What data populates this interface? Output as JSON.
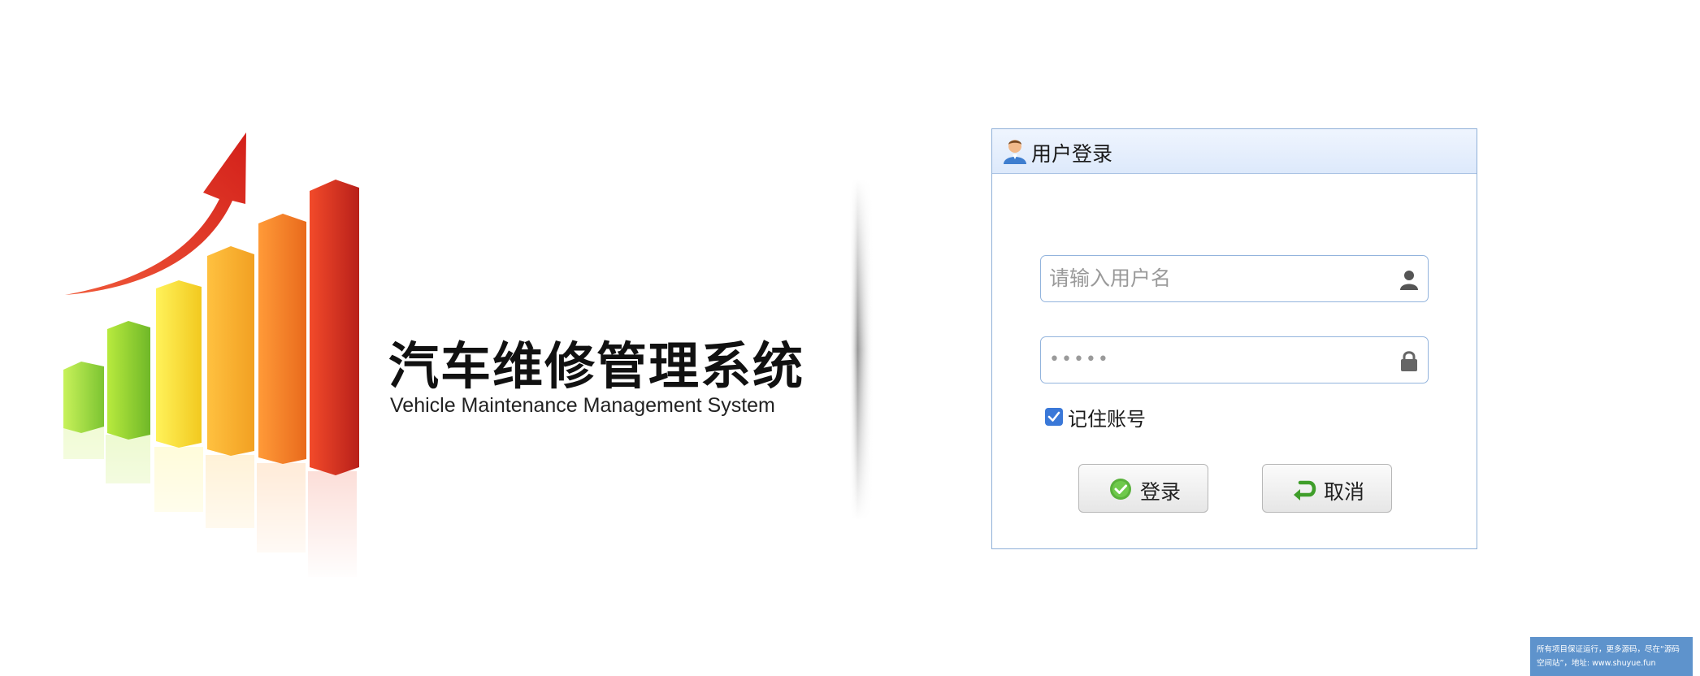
{
  "app": {
    "title_cn": "汽车维修管理系统",
    "title_en": "Vehicle Maintenance Management System",
    "logo": "rising-bar-chart-logo"
  },
  "login": {
    "header_title": "用户登录",
    "header_icon": "user-avatar-icon",
    "username": {
      "placeholder": "请输入用户名",
      "value": "",
      "icon": "user-icon"
    },
    "password": {
      "value": "●●●●●",
      "icon": "lock-icon"
    },
    "remember": {
      "label": "记住账号",
      "checked": true
    },
    "buttons": {
      "login_label": "登录",
      "login_icon": "check-circle-icon",
      "cancel_label": "取消",
      "cancel_icon": "undo-arrow-icon"
    }
  },
  "notice": {
    "line1": "所有项目保证运行，更多源码，尽在“源码",
    "line2": "空间站”，地址: www.shuyue.fun"
  },
  "colors": {
    "panel_border": "#8fb0d8",
    "panel_header": "#dde9fb",
    "checkbox": "#3a78d8",
    "notice_bg": "#5e93cc"
  }
}
